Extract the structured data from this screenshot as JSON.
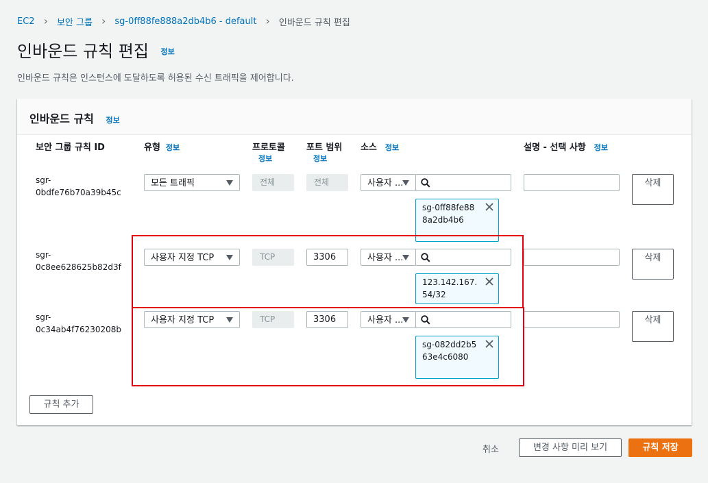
{
  "breadcrumb": {
    "items": [
      "EC2",
      "보안 그룹",
      "sg-0ff88fe888a2db4b6 - default"
    ],
    "current": "인바운드 규칙 편집"
  },
  "page": {
    "title": "인바운드 규칙 편집",
    "info": "정보",
    "description": "인바운드 규칙은 인스턴스에 도달하도록 허용된 수신 트래픽을 제어합니다."
  },
  "panel": {
    "title": "인바운드 규칙",
    "info": "정보",
    "columns": {
      "rule_id": "보안 그룹 규칙 ID",
      "type": "유형",
      "protocol": "프로토콜",
      "port_range": "포트 범위",
      "source": "소스",
      "description": "설명 - 선택 사항",
      "info": "정보"
    },
    "rows": [
      {
        "rule_id": "sgr-0bdfe76b70a39b45c",
        "type": "모든 트래픽",
        "protocol": "전체",
        "port": "전체",
        "source_type": "사용자 ...",
        "token": "sg-0ff88fe888a2db4b6",
        "description": "",
        "delete": "삭제"
      },
      {
        "rule_id": "sgr-0c8ee628625b82d3f",
        "type": "사용자 지정 TCP",
        "protocol": "TCP",
        "port": "3306",
        "source_type": "사용자 ...",
        "token": "123.142.167.54/32",
        "description": "",
        "delete": "삭제"
      },
      {
        "rule_id": "sgr-0c34ab4f76230208b",
        "type": "사용자 지정 TCP",
        "protocol": "TCP",
        "port": "3306",
        "source_type": "사용자 ...",
        "token": "sg-082dd2b563e4c6080",
        "description": "",
        "delete": "삭제"
      }
    ],
    "add_rule": "규칙 추가"
  },
  "footer": {
    "cancel": "취소",
    "preview": "변경 사항 미리 보기",
    "save": "규칙 저장"
  },
  "colors": {
    "link": "#0073bb",
    "primary": "#ec7211",
    "highlight": "#e3000f"
  }
}
